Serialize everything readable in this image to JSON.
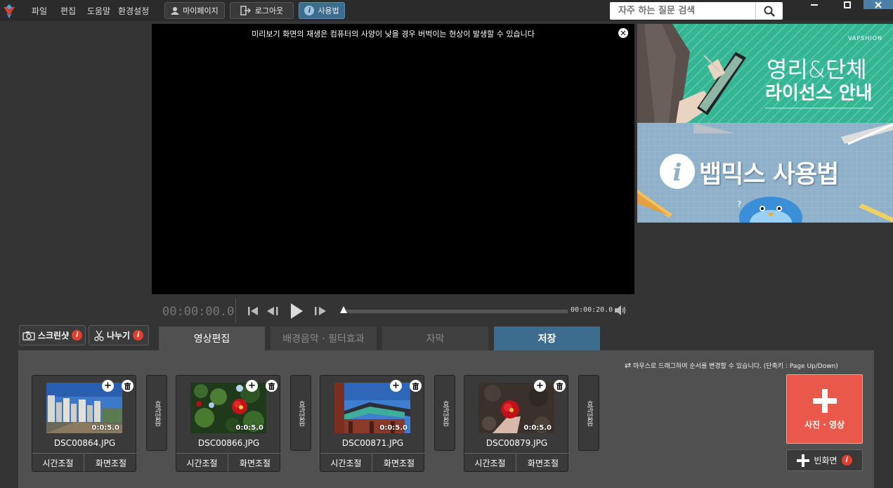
{
  "menu": [
    "파일",
    "편집",
    "도움말",
    "환경설정"
  ],
  "toolbar": {
    "mypage": "마이페이지",
    "logout": "로그아웃",
    "usage": "사용법"
  },
  "search": {
    "placeholder": "자주 하는 질문 검색"
  },
  "preview": {
    "notice": "미리보기 화면의 재생은 컴퓨터의 사양이 낮을 경우 버벅이는 현상이 발생할 수 있습니다"
  },
  "ads": {
    "ad1": {
      "brand": "VAPSHION",
      "line1": "영리&단체",
      "line2": "라이선스 안내"
    },
    "ad2": {
      "title": "뱁믹스 사용법"
    }
  },
  "player": {
    "current_time": "00:00:00.0",
    "end_time": "00:00:20.0",
    "progress": 0
  },
  "tools": {
    "screenshot": "스크린샷",
    "split": "나누기"
  },
  "tabs": [
    {
      "label": "영상편집",
      "state": "active"
    },
    {
      "label": "배경음악 · 필터효과",
      "state": "inactive"
    },
    {
      "label": "자막",
      "state": "inactive"
    },
    {
      "label": "저장",
      "state": "save"
    }
  ],
  "panel": {
    "hint": "마우스로 드래그하여 순서를 변경할 수 있습니다.  (단축키 : Page Up/Down)"
  },
  "clips": [
    {
      "name": "DSC00864.JPG",
      "duration": "0:0:5.0",
      "time_btn": "시간조절",
      "screen_btn": "화면조절"
    },
    {
      "name": "DSC00866.JPG",
      "duration": "0:0:5.0",
      "time_btn": "시간조절",
      "screen_btn": "화면조절"
    },
    {
      "name": "DSC00871.JPG",
      "duration": "0:0:5.0",
      "time_btn": "시간조절",
      "screen_btn": "화면조절"
    },
    {
      "name": "DSC00879.JPG",
      "duration": "0:0:5.0",
      "time_btn": "시간조절",
      "screen_btn": "화면조절"
    }
  ],
  "effect_label": "효과없음",
  "add_media": {
    "label": "사진 · 영상"
  },
  "blank_screen": {
    "label": "빈화면"
  },
  "colors": {
    "accent_blue": "#3c6c8e",
    "add_red": "#e9584a",
    "info_red": "#e2402f"
  }
}
